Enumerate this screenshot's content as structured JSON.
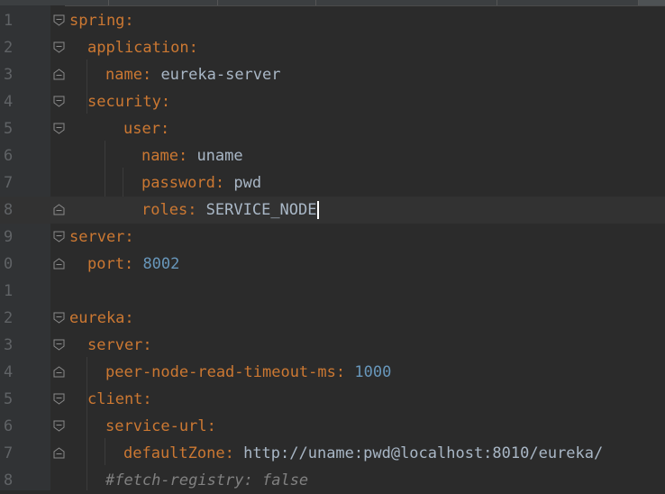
{
  "editor": {
    "lines": [
      {
        "num": "1",
        "key": "spring",
        "sep": ":",
        "value": ""
      },
      {
        "num": "2",
        "key": "application",
        "sep": ":",
        "value": ""
      },
      {
        "num": "3",
        "key": "name",
        "sep": ":",
        "value": " eureka-server"
      },
      {
        "num": "4",
        "key": "security",
        "sep": ":",
        "value": ""
      },
      {
        "num": "5",
        "key": "user",
        "sep": ":",
        "value": ""
      },
      {
        "num": "6",
        "key": "name",
        "sep": ":",
        "value": " uname"
      },
      {
        "num": "7",
        "key": "password",
        "sep": ":",
        "value": " pwd"
      },
      {
        "num": "8",
        "key": "roles",
        "sep": ":",
        "value": " SERVICE_NODE"
      },
      {
        "num": "9",
        "key": "server",
        "sep": ":",
        "value": ""
      },
      {
        "num": "0",
        "key": "port",
        "sep": ":",
        "value": " 8002"
      },
      {
        "num": "1",
        "key": "",
        "sep": "",
        "value": ""
      },
      {
        "num": "2",
        "key": "eureka",
        "sep": ":",
        "value": ""
      },
      {
        "num": "3",
        "key": "server",
        "sep": ":",
        "value": ""
      },
      {
        "num": "4",
        "key": "peer-node-read-timeout-ms",
        "sep": ":",
        "value": " 1000"
      },
      {
        "num": "5",
        "key": "client",
        "sep": ":",
        "value": ""
      },
      {
        "num": "6",
        "key": "service-url",
        "sep": ":",
        "value": ""
      },
      {
        "num": "7",
        "key": "defaultZone",
        "sep": ":",
        "value": " http://uname:pwd@localhost:8010/eureka/"
      },
      {
        "num": "8",
        "comment": "#fetch-registry: false"
      }
    ]
  },
  "colors": {
    "background": "#2b2b2b",
    "key": "#cc7832",
    "string": "#a9b7c6",
    "number": "#6897bb",
    "comment": "#808080",
    "line_number": "#606366"
  }
}
